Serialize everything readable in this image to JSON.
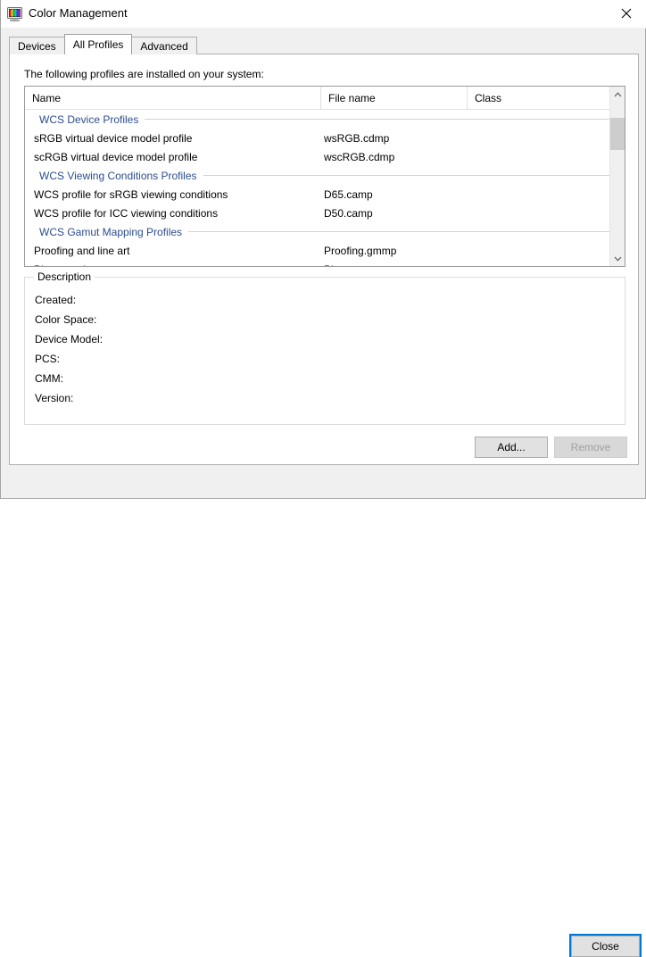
{
  "window": {
    "title": "Color Management",
    "icon": "color-monitor-icon",
    "close_icon": "close-icon",
    "accent_color": "#0078d7",
    "group_header_color": "#2b4d8e"
  },
  "tabs": [
    {
      "label": "Devices",
      "active": false
    },
    {
      "label": "All Profiles",
      "active": true
    },
    {
      "label": "Advanced",
      "active": false
    }
  ],
  "main": {
    "intro": "The following profiles are installed on your system:",
    "columns": [
      "Name",
      "File name",
      "Class"
    ],
    "groups": [
      {
        "label": "WCS Device Profiles",
        "rows": [
          {
            "name": "sRGB virtual device model profile",
            "file": "wsRGB.cdmp",
            "class": ""
          },
          {
            "name": "scRGB virtual device model profile",
            "file": "wscRGB.cdmp",
            "class": ""
          }
        ]
      },
      {
        "label": "WCS Viewing Conditions Profiles",
        "rows": [
          {
            "name": "WCS profile for sRGB viewing conditions",
            "file": "D65.camp",
            "class": ""
          },
          {
            "name": "WCS profile for ICC viewing conditions",
            "file": "D50.camp",
            "class": ""
          }
        ]
      },
      {
        "label": "WCS Gamut Mapping Profiles",
        "rows": [
          {
            "name": "Proofing and line art",
            "file": "Proofing.gmmp",
            "class": ""
          },
          {
            "name": "Photography",
            "file": "Photo.gmmp",
            "class": ""
          }
        ]
      }
    ],
    "scrollbar": {
      "up_icon": "chevron-up-icon",
      "down_icon": "chevron-down-icon"
    }
  },
  "description": {
    "legend": "Description",
    "fields": [
      {
        "label": "Created:",
        "value": ""
      },
      {
        "label": "Color Space:",
        "value": ""
      },
      {
        "label": "Device Model:",
        "value": ""
      },
      {
        "label": "PCS:",
        "value": ""
      },
      {
        "label": "CMM:",
        "value": ""
      },
      {
        "label": "Version:",
        "value": ""
      }
    ]
  },
  "buttons": {
    "add": "Add...",
    "remove": "Remove",
    "close": "Close"
  }
}
